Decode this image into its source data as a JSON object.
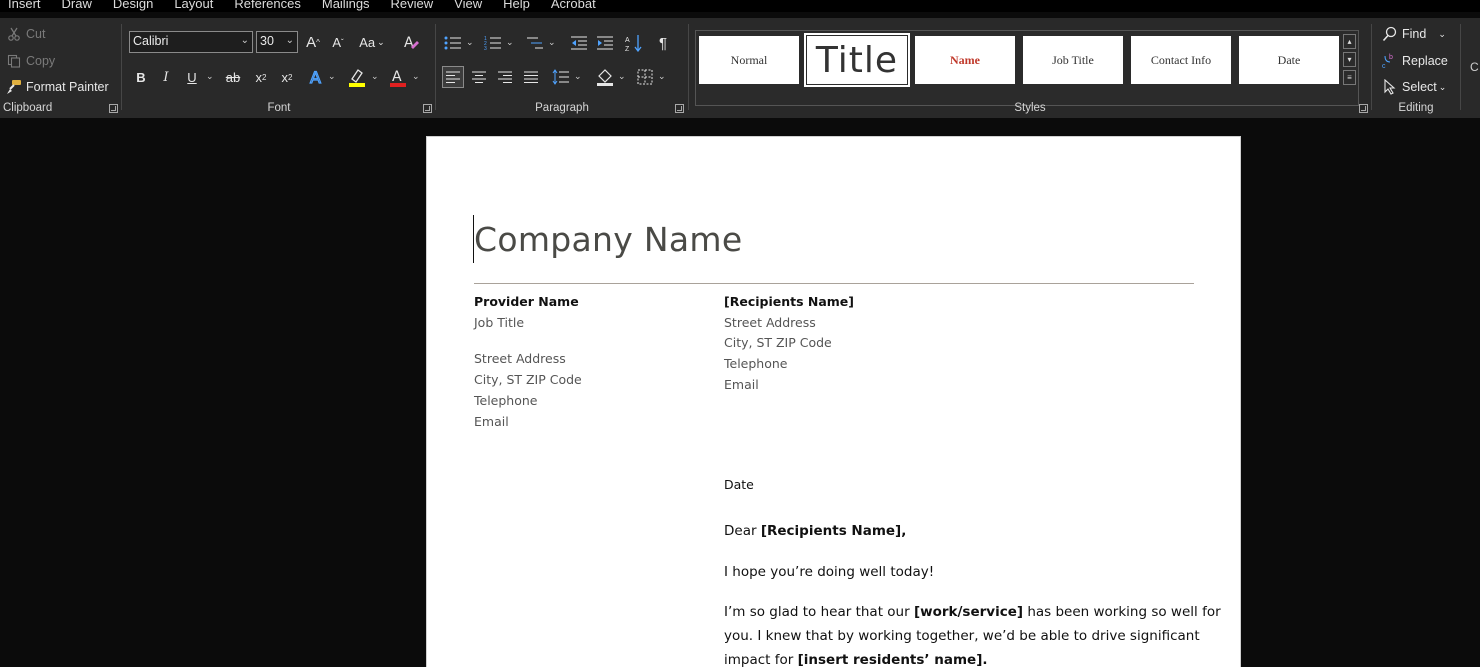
{
  "menu": [
    "Insert",
    "Draw",
    "Design",
    "Layout",
    "References",
    "Mailings",
    "Review",
    "View",
    "Help",
    "Acrobat"
  ],
  "clipboard": {
    "cut": "Cut",
    "copy": "Copy",
    "format_painter": "Format Painter",
    "label": "Clipboard"
  },
  "font": {
    "name": "Calibri",
    "size": "30",
    "label": "Font",
    "grow_glyph": "A",
    "shrink_glyph": "A",
    "case_glyph": "Aa",
    "bold": "B",
    "italic": "I",
    "underline": "U",
    "strike": "ab",
    "subscript": "x",
    "superscript": "x",
    "highlight_color": "#ffff00",
    "font_color": "#e02020"
  },
  "paragraph": {
    "label": "Paragraph",
    "pilcrow": "¶"
  },
  "styles": {
    "label": "Styles",
    "items": [
      "Normal",
      "Title",
      "Name",
      "Job Title",
      "Contact Info",
      "Date"
    ],
    "name_color": "#c0392b"
  },
  "editing": {
    "label": "Editing",
    "find": "Find",
    "replace": "Replace",
    "select": "Select"
  },
  "document": {
    "company": "Company Name",
    "left_col": {
      "provider_name": "Provider Name",
      "job_title": "Job Title",
      "street": "Street Address",
      "city": "City, ST ZIP Code",
      "telephone": "Telephone",
      "email": "Email"
    },
    "right_col": {
      "recipient_name": "[Recipients Name]",
      "street": "Street Address",
      "city": "City, ST ZIP Code",
      "telephone": "Telephone",
      "email": "Email"
    },
    "date": "Date",
    "salutation_prefix": "Dear ",
    "salutation_name": "[Recipients Name],",
    "greeting": "I hope you’re doing well today!",
    "body_1a": "I’m so glad to hear that our ",
    "body_1b": "[work/service]",
    "body_1c": " has been working so well for",
    "body_2": "you. I knew that by working together, we’d be able to drive significant",
    "body_3a": "impact for ",
    "body_3b": "[insert residents’ name]."
  }
}
